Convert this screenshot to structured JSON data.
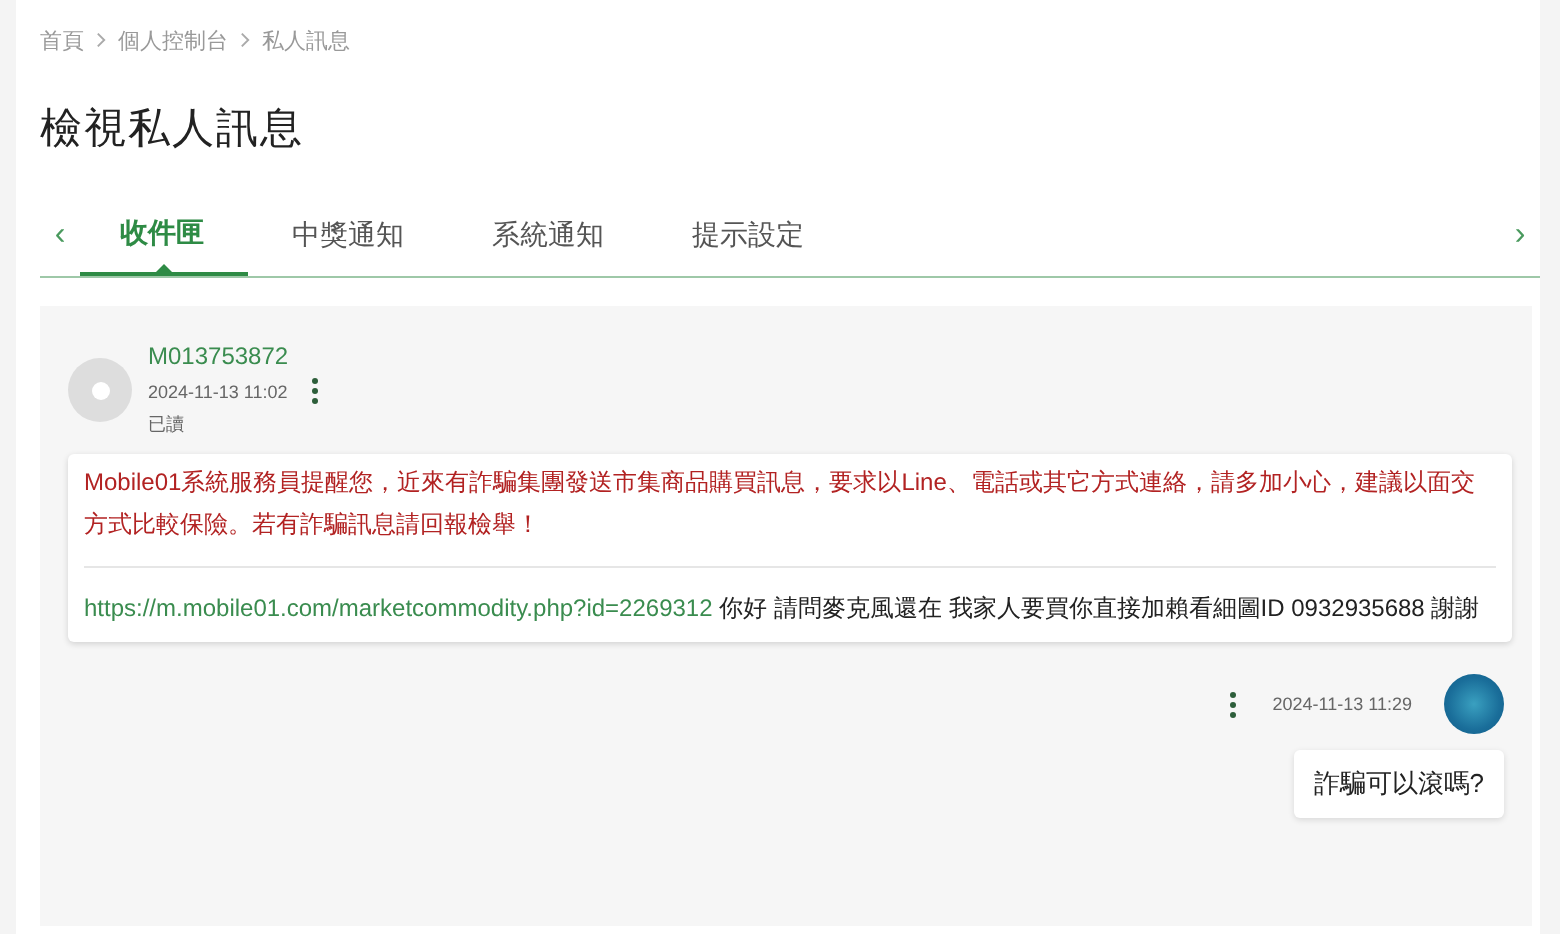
{
  "breadcrumb": [
    "首頁",
    "個人控制台",
    "私人訊息"
  ],
  "title": "檢視私人訊息",
  "tabs": [
    {
      "label": "收件匣",
      "selected": true
    },
    {
      "label": "中獎通知",
      "selected": false
    },
    {
      "label": "系統通知",
      "selected": false
    },
    {
      "label": "提示設定",
      "selected": false
    }
  ],
  "tab_arrows": [
    "‹",
    "›"
  ],
  "messages": [
    {
      "kind": "received",
      "sender": "M013753872",
      "time": "2024-11-13 11:02",
      "status": "已讀",
      "warning": "Mobile01系統服務員提醒您，近來有詐騙集團發送市集商品購買訊息，要求以Line、電話或其它方式連絡，請多加小心，建議以面交方式比較保險。若有詐騙訊息請回報檢舉！",
      "link": "https://m.mobile01.com/marketcommodity.php?id=2269312",
      "text": " 你好 請問麥克風還在 我家人要買你直接加賴看細圖ID 0932935688 謝謝"
    },
    {
      "kind": "sent",
      "time": "2024-11-13 11:29",
      "text": "詐騙可以滾嗎?"
    }
  ]
}
